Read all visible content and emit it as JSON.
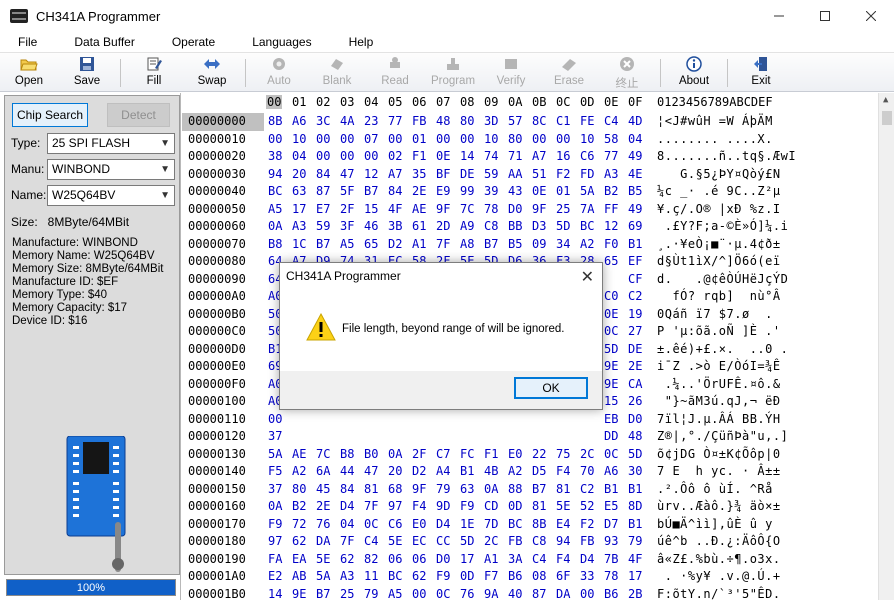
{
  "window": {
    "title": "CH341A Programmer"
  },
  "menu": [
    "File",
    "Data Buffer",
    "Operate",
    "Languages",
    "Help"
  ],
  "toolbar": {
    "open": "Open",
    "save": "Save",
    "fill": "Fill",
    "swap": "Swap",
    "auto": "Auto",
    "blank": "Blank",
    "read": "Read",
    "program": "Program",
    "verify": "Verify",
    "erase": "Erase",
    "stop": "终止",
    "about": "About",
    "exit": "Exit"
  },
  "left": {
    "chip_search": "Chip Search",
    "detect": "Detect",
    "type_label": "Type:",
    "type_value": "25 SPI FLASH",
    "manu_label": "Manu:",
    "manu_value": "WINBOND",
    "name_label": "Name:",
    "name_value": "W25Q64BV",
    "size_line": "Size:   8MByte/64MBit",
    "info": [
      "Manufacture: WINBOND",
      "Memory Name: W25Q64BV",
      "Memory Size: 8MByte/64MBit",
      "Manufacture ID: $EF",
      "Memory Type: $40",
      "Memory Capacity: $17",
      "Device ID: $16"
    ],
    "progress": "100%",
    "progress_value": 100
  },
  "hex": {
    "columns": [
      "00",
      "01",
      "02",
      "03",
      "04",
      "05",
      "06",
      "07",
      "08",
      "09",
      "0A",
      "0B",
      "0C",
      "0D",
      "0E",
      "0F"
    ],
    "ascii_header": "0123456789ABCDEF",
    "addresses": [
      "00000000",
      "00000010",
      "00000020",
      "00000030",
      "00000040",
      "00000050",
      "00000060",
      "00000070",
      "00000080",
      "00000090",
      "000000A0",
      "000000B0",
      "000000C0",
      "000000D0",
      "000000E0",
      "000000F0",
      "00000100",
      "00000110",
      "00000120",
      "00000130",
      "00000140",
      "00000150",
      "00000160",
      "00000170",
      "00000180",
      "00000190",
      "000001A0",
      "000001B0"
    ],
    "rows": [
      [
        "8B",
        "A6",
        "3C",
        "4A",
        "23",
        "77",
        "FB",
        "48",
        "80",
        "3D",
        "57",
        "8C",
        "C1",
        "FE",
        "C4",
        "4D"
      ],
      [
        "00",
        "10",
        "00",
        "00",
        "07",
        "00",
        "01",
        "00",
        "00",
        "10",
        "80",
        "00",
        "00",
        "10",
        "58",
        "04"
      ],
      [
        "38",
        "04",
        "00",
        "00",
        "00",
        "02",
        "F1",
        "0E",
        "14",
        "74",
        "71",
        "A7",
        "16",
        "C6",
        "77",
        "49"
      ],
      [
        "94",
        "20",
        "84",
        "47",
        "12",
        "A7",
        "35",
        "BF",
        "DE",
        "59",
        "AA",
        "51",
        "F2",
        "FD",
        "A3",
        "4E"
      ],
      [
        "BC",
        "63",
        "87",
        "5F",
        "B7",
        "84",
        "2E",
        "E9",
        "99",
        "39",
        "43",
        "0E",
        "01",
        "5A",
        "B2",
        "B5"
      ],
      [
        "A5",
        "17",
        "E7",
        "2F",
        "15",
        "4F",
        "AE",
        "9F",
        "7C",
        "78",
        "D0",
        "9F",
        "25",
        "7A",
        "FF",
        "49"
      ],
      [
        "0A",
        "A3",
        "59",
        "3F",
        "46",
        "3B",
        "61",
        "2D",
        "A9",
        "C8",
        "BB",
        "D3",
        "5D",
        "BC",
        "12",
        "69"
      ],
      [
        "B8",
        "1C",
        "B7",
        "A5",
        "65",
        "D2",
        "A1",
        "7F",
        "A8",
        "B7",
        "B5",
        "09",
        "34",
        "A2",
        "F0",
        "B1"
      ],
      [
        "64",
        "A7",
        "D9",
        "74",
        "31",
        "EC",
        "58",
        "2F",
        "5E",
        "5D",
        "D6",
        "36",
        "F3",
        "28",
        "65",
        "EF"
      ],
      [
        "64",
        "",
        "",
        "",
        "",
        "",
        "",
        "",
        "",
        "",
        "",
        "",
        "",
        "",
        "",
        "CF"
      ],
      [
        "A0",
        "",
        "",
        "",
        "",
        "",
        "",
        "",
        "",
        "",
        "",
        "",
        "",
        "",
        "C0",
        "C2"
      ],
      [
        "50",
        "",
        "",
        "",
        "",
        "",
        "",
        "",
        "",
        "",
        "",
        "",
        "",
        "",
        "0E",
        "19"
      ],
      [
        "50",
        "",
        "",
        "",
        "",
        "",
        "",
        "",
        "",
        "",
        "",
        "",
        "",
        "",
        "0C",
        "27"
      ],
      [
        "B1",
        "",
        "",
        "",
        "",
        "",
        "",
        "",
        "",
        "",
        "",
        "",
        "",
        "",
        "5D",
        "DE"
      ],
      [
        "69",
        "",
        "",
        "",
        "",
        "",
        "",
        "",
        "",
        "",
        "",
        "",
        "",
        "",
        "9E",
        "2E"
      ],
      [
        "A0",
        "",
        "",
        "",
        "",
        "",
        "",
        "",
        "",
        "",
        "",
        "",
        "",
        "",
        "9E",
        "CA"
      ],
      [
        "A0",
        "",
        "",
        "",
        "",
        "",
        "",
        "",
        "",
        "",
        "",
        "",
        "",
        "",
        "15",
        "26"
      ],
      [
        "00",
        "",
        "",
        "",
        "",
        "",
        "",
        "",
        "",
        "",
        "",
        "",
        "",
        "",
        "EB",
        "D0"
      ],
      [
        "37",
        "",
        "",
        "",
        "",
        "",
        "",
        "",
        "",
        "",
        "",
        "",
        "",
        "",
        "DD",
        "48"
      ],
      [
        "5A",
        "AE",
        "7C",
        "B8",
        "B0",
        "0A",
        "2F",
        "C7",
        "FC",
        "F1",
        "E0",
        "22",
        "75",
        "2C",
        "0C",
        "5D"
      ],
      [
        "F5",
        "A2",
        "6A",
        "44",
        "47",
        "20",
        "D2",
        "A4",
        "B1",
        "4B",
        "A2",
        "D5",
        "F4",
        "70",
        "A6",
        "30"
      ],
      [
        "37",
        "80",
        "45",
        "84",
        "81",
        "68",
        "9F",
        "79",
        "63",
        "0A",
        "88",
        "B7",
        "81",
        "C2",
        "B1",
        "B1"
      ],
      [
        "0A",
        "B2",
        "2E",
        "D4",
        "7F",
        "97",
        "F4",
        "9D",
        "F9",
        "CD",
        "0D",
        "81",
        "5E",
        "52",
        "E5",
        "8D"
      ],
      [
        "F9",
        "72",
        "76",
        "04",
        "0C",
        "C6",
        "E0",
        "D4",
        "1E",
        "7D",
        "BC",
        "8B",
        "E4",
        "F2",
        "D7",
        "B1"
      ],
      [
        "97",
        "62",
        "DA",
        "7F",
        "C4",
        "5E",
        "EC",
        "CC",
        "5D",
        "2C",
        "FB",
        "C8",
        "94",
        "FB",
        "93",
        "79"
      ],
      [
        "FA",
        "EA",
        "5E",
        "62",
        "82",
        "06",
        "06",
        "D0",
        "17",
        "A1",
        "3A",
        "C4",
        "F4",
        "D4",
        "7B",
        "4F"
      ],
      [
        "E2",
        "AB",
        "5A",
        "A3",
        "11",
        "BC",
        "62",
        "F9",
        "0D",
        "F7",
        "B6",
        "08",
        "6F",
        "33",
        "78",
        "17"
      ],
      [
        "14",
        "9E",
        "B7",
        "25",
        "79",
        "A5",
        "00",
        "0C",
        "76",
        "9A",
        "40",
        "87",
        "DA",
        "00",
        "B6",
        "2B"
      ]
    ],
    "ascii": [
      "¦<J#wûH =W ÁþÄM",
      "........ ....X.",
      "8.......ñ..tq§.ÆwI",
      "   G.§5¿ÞY¤Qòý£N",
      "¼c _· .é 9C..Z²µ",
      "¥.ç/.O® |xÐ %z.I",
      " .£Y?F;a-©È»Ó]¼.i",
      "¸.·¥eÒ¡■¨·µ.4¢ð±",
      "d§Ùt1ìX/^]Ö6ó(eï",
      "d.   .@¢êÒÚHëJçÝD",
      "  fÓ? rqb]  nù°Â",
      "0Qáñ ï7 $7.ø  .",
      "P 'µ:õã.oÑ ]È .'",
      "±.êé)+£.×.  ..0 .",
      "i¯Z .>ò E/ÒóI=¾Ê",
      " .¼..'ÖrUFÊ.¤ô.&",
      " \"}~ãM3ú.qJ,¬ ëÐ",
      "7ïl¦J.µ.ÂÁ BB.ÝH",
      "Z®|,°./ÇüñÞà\"u,.]",
      "õ¢jDG Ò¤±K¢Õôp|0",
      "7 E  h yc. · Â±±",
      ".².Ôô ô ùÍ. ^Rå",
      "ùrv..Æàô.}¾ äò×±",
      "bÚ■Ä^ìì],ûÈ û y",
      "úê^b ..Ð.¿:ÄôÔ{O",
      "â«Z£.%bù.÷¶.o3x.",
      " . ·%y¥ .v.@.Ú.+",
      "F:õtY.n/`³'5\"ÊD."
    ]
  },
  "dialog": {
    "title": "CH341A Programmer",
    "message": "File length, beyond range of will be ignored.",
    "ok": "OK"
  }
}
